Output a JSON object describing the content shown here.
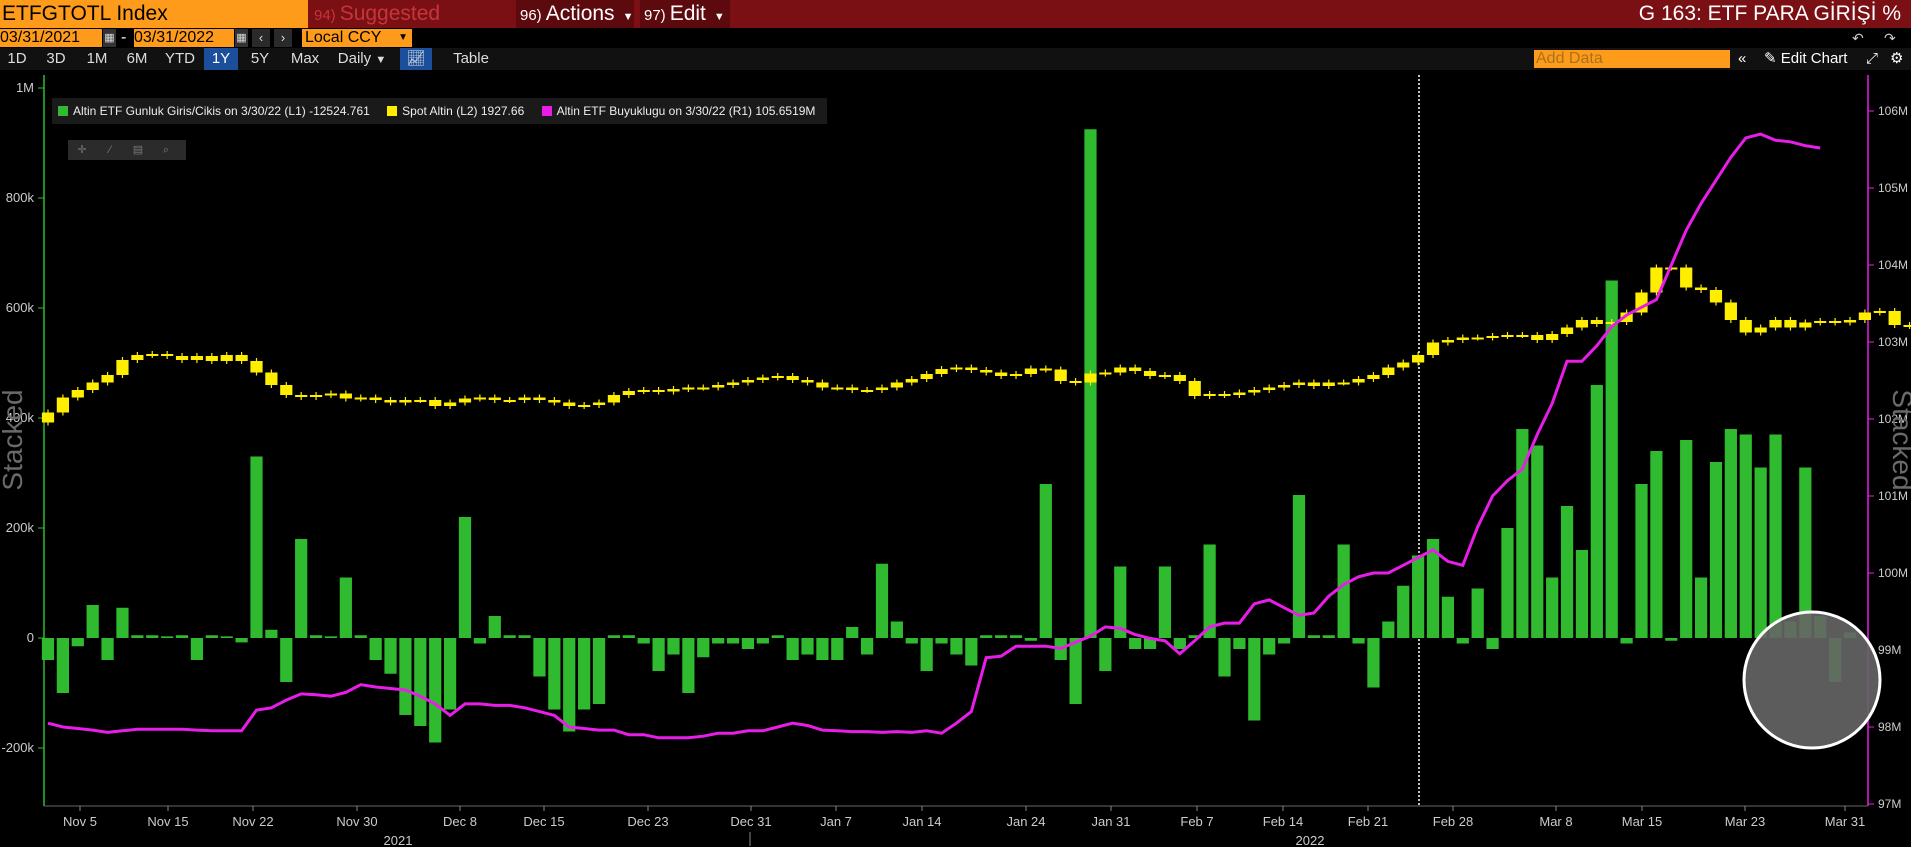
{
  "toolbar": {
    "ticker": "ETFGTOTL Index",
    "suggested_num": "94)",
    "suggested_label": "Suggested Charts",
    "actions_num": "96)",
    "actions_label": "Actions",
    "edit_num": "97)",
    "edit_label": "Edit",
    "chart_title": "G 163: ETF PARA GİRİŞİ %"
  },
  "range": {
    "start": "03/31/2021",
    "end": "03/31/2022",
    "separator": "-",
    "currency": "Local CCY"
  },
  "timeframes": [
    "1D",
    "3D",
    "1M",
    "6M",
    "YTD",
    "1Y",
    "5Y",
    "Max"
  ],
  "selected_timeframe": "1Y",
  "frequency": "Daily",
  "table_label": "Table",
  "add_data_placeholder": "Add Data",
  "edit_chart_label": "Edit Chart",
  "colors": {
    "green": "#2fba2f",
    "yellow": "#ffee00",
    "magenta": "#e81ee8",
    "accent": "#ff9b1a",
    "bar": "#7a0f14"
  },
  "legend": [
    {
      "color": "#2fba2f",
      "text": "Altin ETF Gunluk Giris/Cikis on 3/30/22 (L1)  -12524.761"
    },
    {
      "color": "#ffee00",
      "text": "Spot Altin (L2)  1927.66"
    },
    {
      "color": "#e81ee8",
      "text": "Altin ETF Buyuklugu on 3/30/22 (R1)  105.6519M"
    }
  ],
  "chart_data": {
    "type": "bar",
    "left_axis_label": "Stacked",
    "right_axis_label": "Stacked",
    "left_ticks": [
      "1M",
      "800k",
      "600k",
      "400k",
      "200k",
      "0",
      "-200k"
    ],
    "right_ticks": [
      "106M",
      "105M",
      "104M",
      "103M",
      "102M",
      "101M",
      "100M",
      "99M",
      "98M",
      "97M"
    ],
    "x_ticks": [
      "Nov 5",
      "Nov 15",
      "Nov 22",
      "Nov 30",
      "Dec 8",
      "Dec 15",
      "Dec 23",
      "Dec 31",
      "Jan 7",
      "Jan 14",
      "Jan 24",
      "Jan 31",
      "Feb 7",
      "Feb 14",
      "Feb 21",
      "Feb 28",
      "Mar 8",
      "Mar 15",
      "Mar 23",
      "Mar 31"
    ],
    "years": [
      "2021",
      "2022"
    ],
    "flows": [
      -40000,
      -100000,
      -15000,
      60000,
      -40000,
      55000,
      5000,
      5000,
      3000,
      5000,
      -40000,
      5000,
      3000,
      -8000,
      330000,
      15000,
      -80000,
      180000,
      5000,
      3000,
      110000,
      5000,
      -40000,
      -65000,
      -140000,
      -160000,
      -190000,
      -130000,
      220000,
      -10000,
      40000,
      5000,
      5000,
      -70000,
      -130000,
      -170000,
      -130000,
      -120000,
      5000,
      5000,
      -10000,
      -60000,
      -30000,
      -100000,
      -35000,
      -10000,
      -10000,
      -20000,
      -10000,
      5000,
      -40000,
      -30000,
      -40000,
      -40000,
      20000,
      -30000,
      135000,
      30000,
      -10000,
      -60000,
      -10000,
      -30000,
      -50000,
      5000,
      5000,
      5000,
      -5000,
      280000,
      -40000,
      -120000,
      925000,
      -60000,
      130000,
      -20000,
      -20000,
      130000,
      -20000,
      5000,
      170000,
      -70000,
      -20000,
      -150000,
      -30000,
      -10000,
      260000,
      5000,
      5000,
      170000,
      -10000,
      -90000,
      30000,
      95000,
      150000,
      180000,
      75000,
      -10000,
      90000,
      -20000,
      200000,
      380000,
      350000,
      110000,
      240000,
      160000,
      460000,
      650000,
      -10000,
      280000,
      340000,
      -5000,
      360000,
      110000,
      320000,
      380000,
      370000,
      310000,
      370000,
      30000,
      310000,
      40000,
      -80000,
      10000
    ],
    "gold": [
      1755,
      1785,
      1800,
      1815,
      1830,
      1860,
      1870,
      1872,
      1868,
      1860,
      1868,
      1858,
      1870,
      1858,
      1835,
      1810,
      1790,
      1786,
      1790,
      1793,
      1783,
      1785,
      1780,
      1775,
      1780,
      1780,
      1768,
      1775,
      1783,
      1785,
      1780,
      1780,
      1785,
      1780,
      1775,
      1768,
      1770,
      1775,
      1790,
      1798,
      1800,
      1797,
      1802,
      1805,
      1805,
      1810,
      1815,
      1820,
      1825,
      1828,
      1820,
      1815,
      1805,
      1805,
      1800,
      1800,
      1805,
      1815,
      1822,
      1832,
      1842,
      1845,
      1840,
      1835,
      1828,
      1832,
      1843,
      1841,
      1818,
      1815,
      1833,
      1835,
      1845,
      1838,
      1828,
      1830,
      1818,
      1788,
      1792,
      1790,
      1795,
      1800,
      1805,
      1810,
      1815,
      1808,
      1815,
      1815,
      1822,
      1830,
      1845,
      1855,
      1870,
      1895,
      1900,
      1905,
      1905,
      1908,
      1910,
      1910,
      1900,
      1912,
      1925,
      1940,
      1932,
      1936,
      1955,
      1995,
      2045,
      2045,
      2005,
      2000,
      1975,
      1940,
      1915,
      1925,
      1940,
      1925,
      1935,
      1938,
      1935,
      1940,
      1955,
      1958,
      1930,
      1928,
      1932,
      1938,
      1930
    ],
    "size": [
      98.05,
      98.0,
      97.98,
      97.96,
      97.93,
      97.95,
      97.97,
      97.97,
      97.97,
      97.97,
      97.96,
      97.95,
      97.95,
      97.95,
      98.22,
      98.25,
      98.35,
      98.43,
      98.42,
      98.4,
      98.45,
      98.55,
      98.52,
      98.5,
      98.48,
      98.4,
      98.3,
      98.15,
      98.3,
      98.3,
      98.28,
      98.28,
      98.25,
      98.2,
      98.15,
      98.0,
      97.98,
      97.96,
      97.96,
      97.9,
      97.9,
      97.86,
      97.86,
      97.86,
      97.88,
      97.92,
      97.92,
      97.95,
      97.95,
      98.0,
      98.05,
      98.02,
      97.96,
      97.95,
      97.94,
      97.94,
      97.93,
      97.94,
      97.93,
      97.95,
      97.92,
      98.05,
      98.2,
      98.9,
      98.92,
      99.05,
      99.05,
      99.05,
      99.02,
      99.1,
      99.18,
      99.3,
      99.28,
      99.2,
      99.15,
      99.12,
      98.95,
      99.12,
      99.3,
      99.35,
      99.35,
      99.6,
      99.65,
      99.55,
      99.45,
      99.48,
      99.7,
      99.85,
      99.95,
      100.0,
      100.0,
      100.1,
      100.2,
      100.3,
      100.15,
      100.1,
      100.6,
      101.0,
      101.2,
      101.35,
      101.8,
      102.2,
      102.75,
      102.75,
      102.95,
      103.2,
      103.35,
      103.45,
      103.55,
      104.0,
      104.45,
      104.8,
      105.1,
      105.4,
      105.65,
      105.7,
      105.62,
      105.6,
      105.55,
      105.52
    ]
  }
}
